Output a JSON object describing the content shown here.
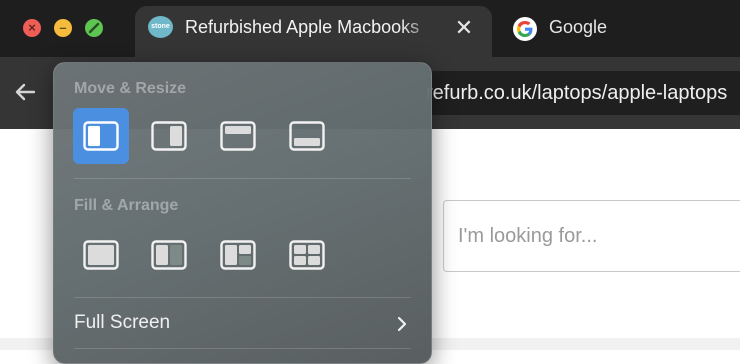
{
  "window": {
    "controls": {
      "close": "close-icon",
      "minimize": "minimize-icon",
      "zoom": "fullscreen-icon"
    }
  },
  "tabs": [
    {
      "title": "Refurbished Apple Macbooks",
      "favicon": "store-favicon",
      "favicon_text": "stone",
      "close_icon": "close-icon",
      "active": true
    },
    {
      "title": "Google",
      "favicon": "google-favicon",
      "active": false
    }
  ],
  "toolbar": {
    "back_icon": "arrow-left-icon",
    "url": "refurb.co.uk/laptops/apple-laptops"
  },
  "page": {
    "search": {
      "placeholder": "I'm looking for..."
    }
  },
  "window_menu": {
    "move_resize": {
      "label": "Move & Resize",
      "options": [
        {
          "name": "tile-left-icon",
          "selected": true
        },
        {
          "name": "tile-right-icon",
          "selected": false
        },
        {
          "name": "tile-top-icon",
          "selected": false
        },
        {
          "name": "tile-bottom-icon",
          "selected": false
        }
      ]
    },
    "fill_arrange": {
      "label": "Fill & Arrange",
      "options": [
        {
          "name": "fill-icon"
        },
        {
          "name": "split-halves-icon"
        },
        {
          "name": "split-left-quarters-icon"
        },
        {
          "name": "quarters-icon"
        }
      ]
    },
    "full_screen": {
      "label": "Full Screen",
      "icon": "chevron-right-icon"
    }
  },
  "colors": {
    "tabstrip": "#1e1e1e",
    "toolbar": "#353535",
    "accent_selected": "#4a8fe0",
    "close": "#ee5d56",
    "minimize": "#f5bb3c",
    "zoom": "#5fc552"
  }
}
